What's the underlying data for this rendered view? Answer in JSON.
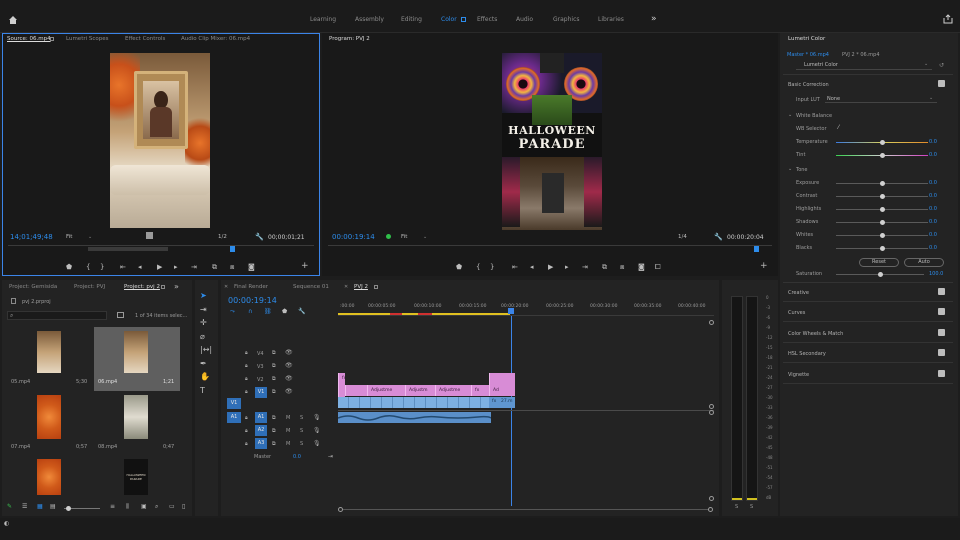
{
  "workspaces": [
    "Learning",
    "Assembly",
    "Editing",
    "Color",
    "Effects",
    "Audio",
    "Graphics",
    "Libraries"
  ],
  "active_workspace": "Color",
  "more_glyph": "»",
  "source": {
    "tabs": [
      "Source: 06.mp4",
      "Lumetri Scopes",
      "Effect Controls",
      "Audio Clip Mixer: 06.mp4"
    ],
    "timecode": "14;01;49;48",
    "fit": "Fit",
    "resolution": "1/2",
    "duration": "00;00;01;21"
  },
  "program": {
    "tab": "Program: PVJ 2",
    "timecode": "00:00:19:14",
    "fit": "Fit",
    "resolution": "1/4",
    "duration": "00:00:20:04",
    "title_line1": "HALLOWEEN",
    "title_line2": "PARADE"
  },
  "lumetri": {
    "tab": "Lumetri Color",
    "master": "Master * 06.mp4",
    "sequence": "PVJ 2 * 06.mp4",
    "effect": "Lumetri Color",
    "basic_correction": "Basic Correction",
    "input_lut_label": "Input LUT",
    "input_lut_value": "None",
    "white_balance": "White Balance",
    "wb_selector": "WB Selector",
    "wb_sliders": [
      {
        "label": "Temperature",
        "value": "0.0",
        "pos": 0.5
      },
      {
        "label": "Tint",
        "value": "0.0",
        "pos": 0.5
      }
    ],
    "tone": "Tone",
    "tone_sliders": [
      {
        "label": "Exposure",
        "value": "0.0",
        "pos": 0.5
      },
      {
        "label": "Contrast",
        "value": "0.0",
        "pos": 0.5
      },
      {
        "label": "Highlights",
        "value": "0.0",
        "pos": 0.5
      },
      {
        "label": "Shadows",
        "value": "0.0",
        "pos": 0.5
      },
      {
        "label": "Whites",
        "value": "0.0",
        "pos": 0.5
      },
      {
        "label": "Blacks",
        "value": "0.0",
        "pos": 0.5
      }
    ],
    "reset": "Reset",
    "auto": "Auto",
    "saturation_label": "Saturation",
    "saturation_value": "100.0",
    "saturation_pos": 0.5,
    "sections": [
      "Creative",
      "Curves",
      "Color Wheels & Match",
      "HSL Secondary",
      "Vignette"
    ]
  },
  "project": {
    "tabs": [
      "Project: Gemisida",
      "Project: PVJ",
      "Project: pvj 2"
    ],
    "file": "pvj 2.prproj",
    "items_count": "1 of 34 items selec...",
    "items": [
      {
        "name": "05.mp4",
        "dur": "5;30"
      },
      {
        "name": "06.mp4",
        "dur": "1;21"
      },
      {
        "name": "07.mp4",
        "dur": "0;57"
      },
      {
        "name": "08.mp4",
        "dur": "0;47"
      }
    ],
    "thumb_text": "HALLOWEEN PARADE"
  },
  "timeline": {
    "tabs": [
      "Final Render",
      "Sequence 01",
      "PVJ 2"
    ],
    "timecode": "00:00:19:14",
    "ruler": [
      ":00:00",
      "00:00:05:00",
      "00:00:10:00",
      "00:00:15:00",
      "00:00:20:00",
      "00:00:25:00",
      "00:00:30:00",
      "00:00:35:00",
      "00:00:40:00"
    ],
    "video_tracks": [
      "V3",
      "V2",
      "V1"
    ],
    "video_tracks_top": [
      "V4"
    ],
    "audio_tracks": [
      "A1",
      "A2",
      "A3"
    ],
    "src_v": "V1",
    "src_a": "A1",
    "master_label": "Master",
    "master_value": "0.0",
    "mute": "M",
    "solo": "S",
    "v2_clips": [
      "fx",
      "Adjustme",
      "Adjustm",
      "Adjustme",
      "fx",
      "Ad"
    ],
    "v1_clip_label": "fx",
    "v1_last_label": "27.m"
  },
  "meters": {
    "ticks": [
      "0",
      "-3",
      "-6",
      "-9",
      "-12",
      "-15",
      "-18",
      "-21",
      "-24",
      "-27",
      "-30",
      "-33",
      "-36",
      "-39",
      "-42",
      "-45",
      "-48",
      "-51",
      "-54",
      "-57",
      "dB"
    ],
    "solo": [
      "S",
      "S"
    ]
  },
  "colors": {
    "accent": "#2d8ceb",
    "clip_pink": "#d88cd6",
    "clip_blue": "#7db0e2",
    "playhead": "#3b84e8"
  }
}
